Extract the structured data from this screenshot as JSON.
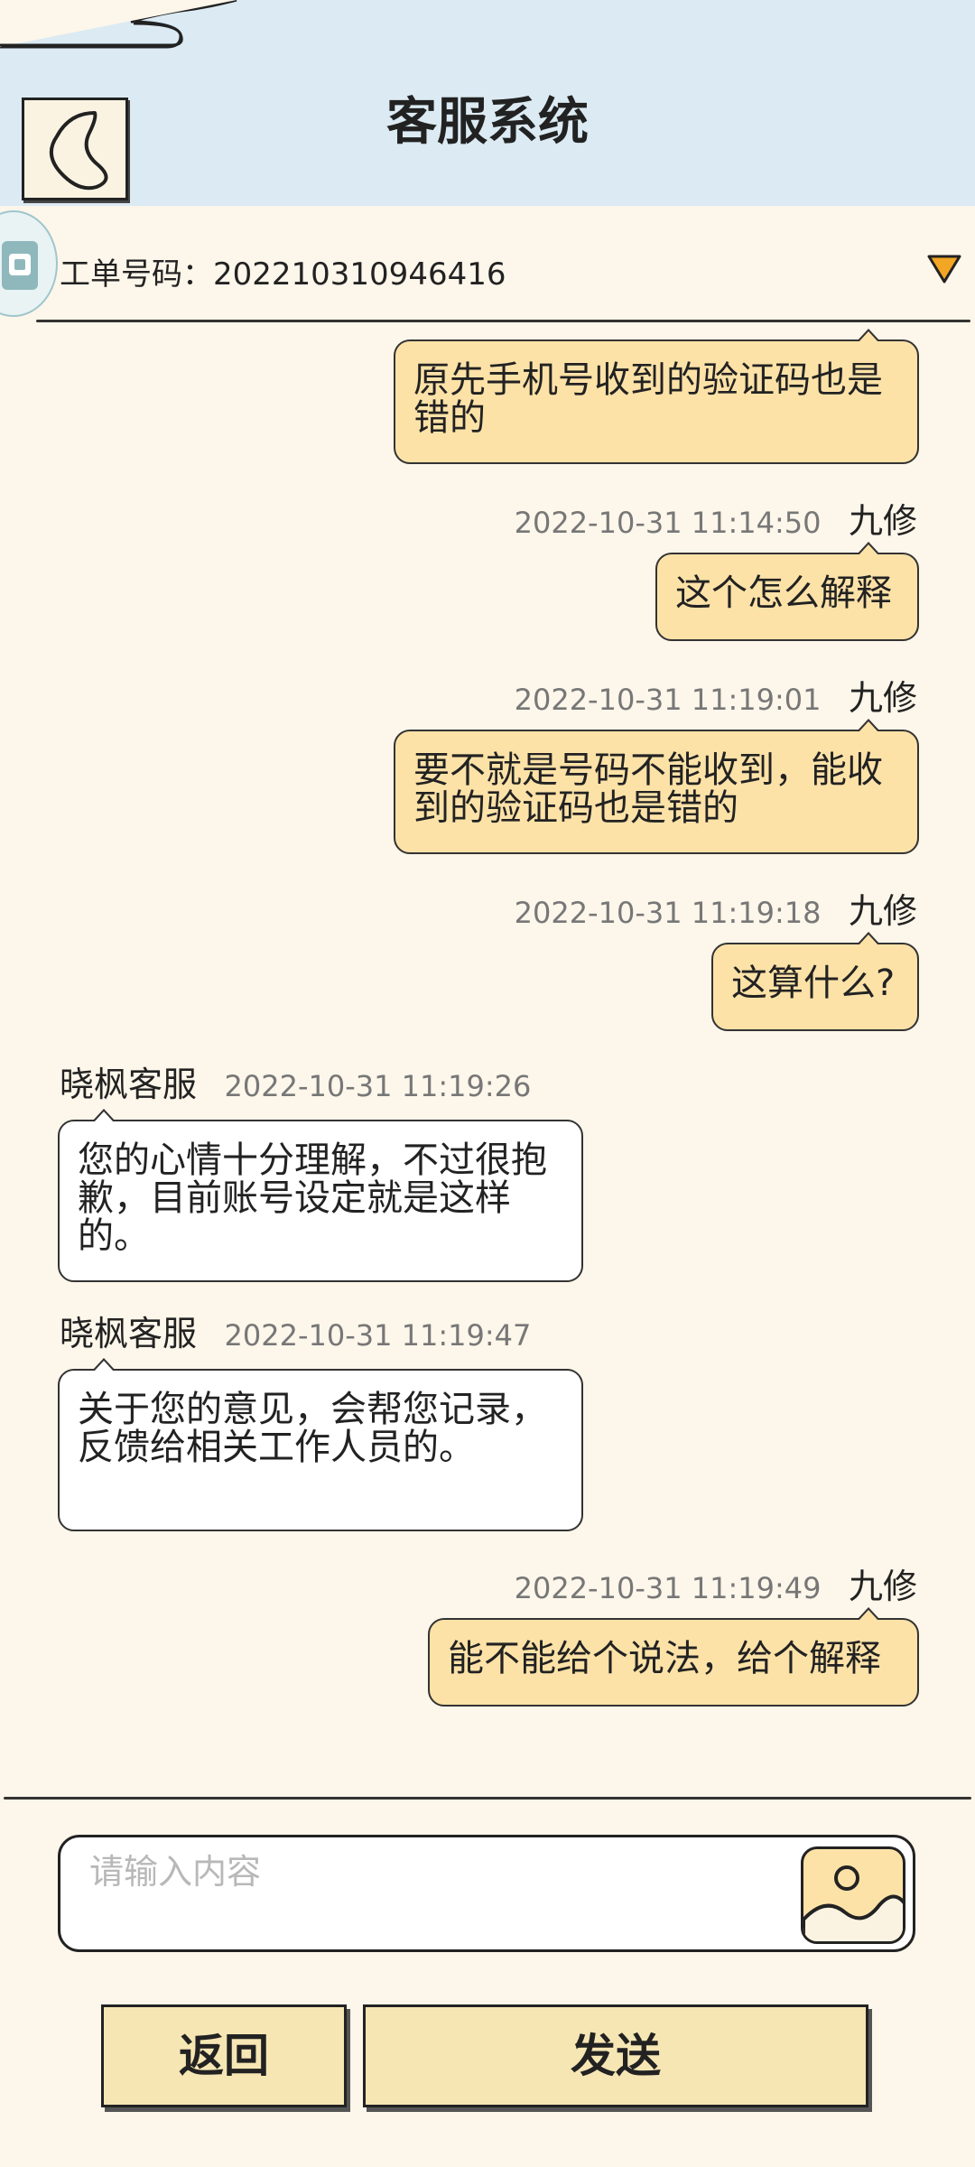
{
  "header": {
    "title": "客服系统"
  },
  "ticket": {
    "label": "工单号码：202210310946416"
  },
  "messages": [
    {
      "side": "user",
      "name": "",
      "time": "",
      "text": "原先手机号收到的验证码也是错的"
    },
    {
      "side": "user",
      "name": "九修",
      "time": "2022-10-31 11:14:50",
      "text": "这个怎么解释"
    },
    {
      "side": "user",
      "name": "九修",
      "time": "2022-10-31 11:19:01",
      "text": "要不就是号码不能收到，能收到的验证码也是错的"
    },
    {
      "side": "user",
      "name": "九修",
      "time": "2022-10-31 11:19:18",
      "text": "这算什么?"
    },
    {
      "side": "agent",
      "name": "晓枫客服",
      "time": "2022-10-31 11:19:26",
      "text": "您的心情十分理解，不过很抱歉，目前账号设定就是这样的。"
    },
    {
      "side": "agent",
      "name": "晓枫客服",
      "time": "2022-10-31 11:19:47",
      "text": "关于您的意见，会帮您记录，反馈给相关工作人员的。"
    },
    {
      "side": "user",
      "name": "九修",
      "time": "2022-10-31 11:19:49",
      "text": "能不能给个说法，给个解释"
    }
  ],
  "input": {
    "placeholder": "请输入内容",
    "value": ""
  },
  "buttons": {
    "back": "返回",
    "send": "发送"
  },
  "colors": {
    "header_bg": "#dbeaf3",
    "page_bg": "#fdf6ea",
    "user_bubble": "#fde2a8",
    "agent_bubble": "#ffffff",
    "button_bg": "#f6e6b4"
  },
  "icons": {
    "back": "back-chevron-icon",
    "ticket": "ticket-icon",
    "dropdown": "dropdown-triangle-icon",
    "image": "image-upload-icon"
  }
}
